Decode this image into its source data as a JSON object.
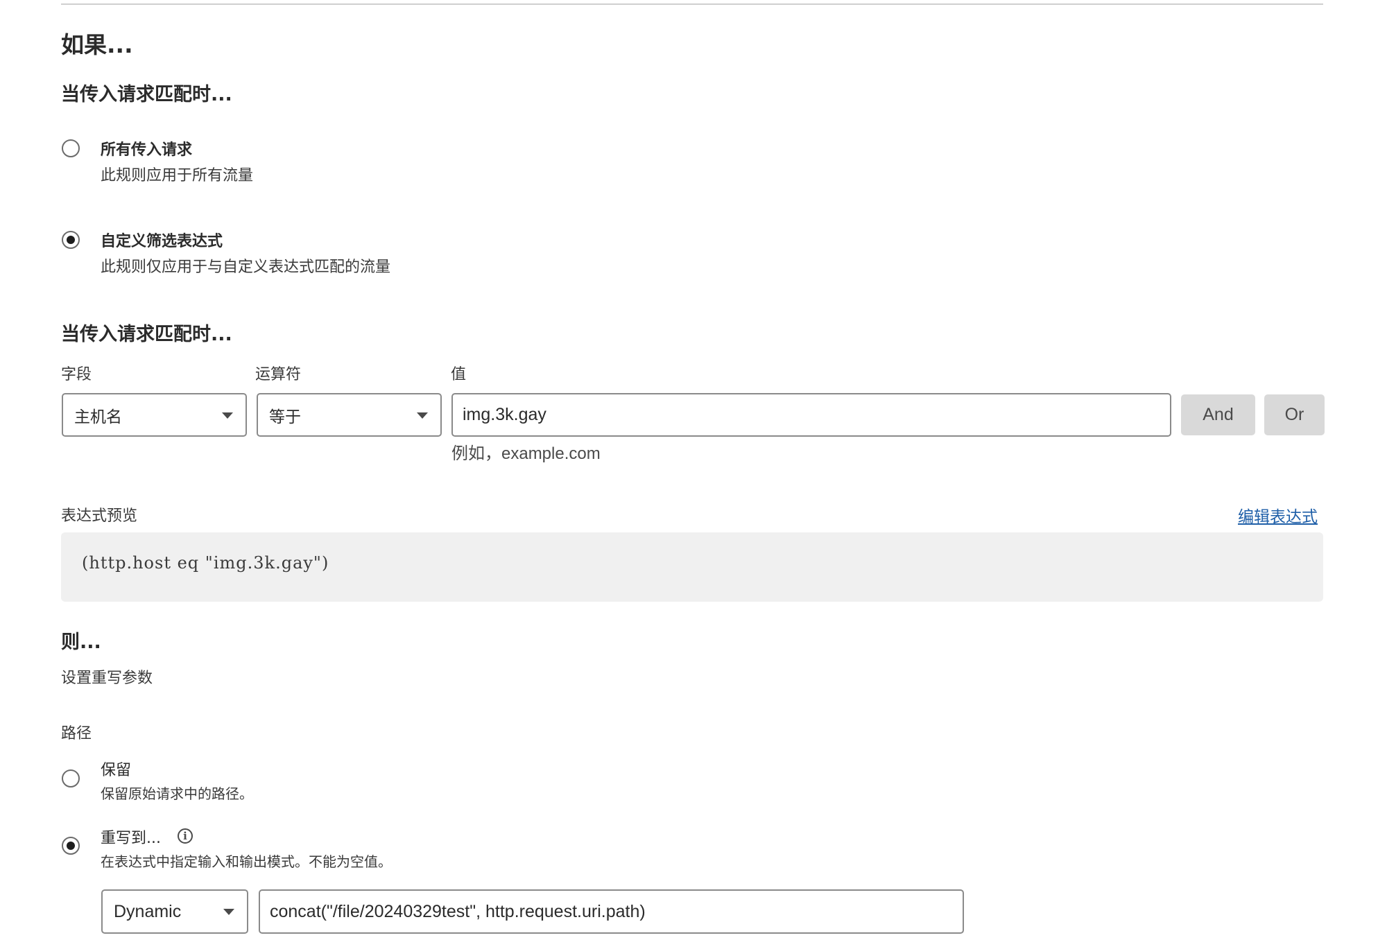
{
  "if_section": {
    "heading": "如果...",
    "match_heading": "当传入请求匹配时...",
    "options": [
      {
        "title": "所有传入请求",
        "desc": "此规则应用于所有流量",
        "checked": false
      },
      {
        "title": "自定义筛选表达式",
        "desc": "此规则仅应用于与自定义表达式匹配的流量",
        "checked": true
      }
    ]
  },
  "filter": {
    "heading": "当传入请求匹配时...",
    "field_label": "字段",
    "operator_label": "运算符",
    "value_label": "值",
    "field_value": "主机名",
    "operator_value": "等于",
    "value_input": "img.3k.gay",
    "value_hint": "例如，example.com",
    "and_button": "And",
    "or_button": "Or"
  },
  "preview": {
    "label": "表达式预览",
    "edit_link": "编辑表达式",
    "expression": "(http.host eq \"img.3k.gay\")"
  },
  "then_section": {
    "heading": "则...",
    "subheading": "设置重写参数",
    "path_label": "路径",
    "options": [
      {
        "title": "保留",
        "desc": "保留原始请求中的路径。",
        "checked": false
      },
      {
        "title": "重写到...",
        "desc": "在表达式中指定输入和输出模式。不能为空值。",
        "checked": true
      }
    ],
    "info_icon": "info-icon",
    "rewrite_type": "Dynamic",
    "rewrite_value": "concat(\"/file/20240329test\", http.request.uri.path)"
  }
}
